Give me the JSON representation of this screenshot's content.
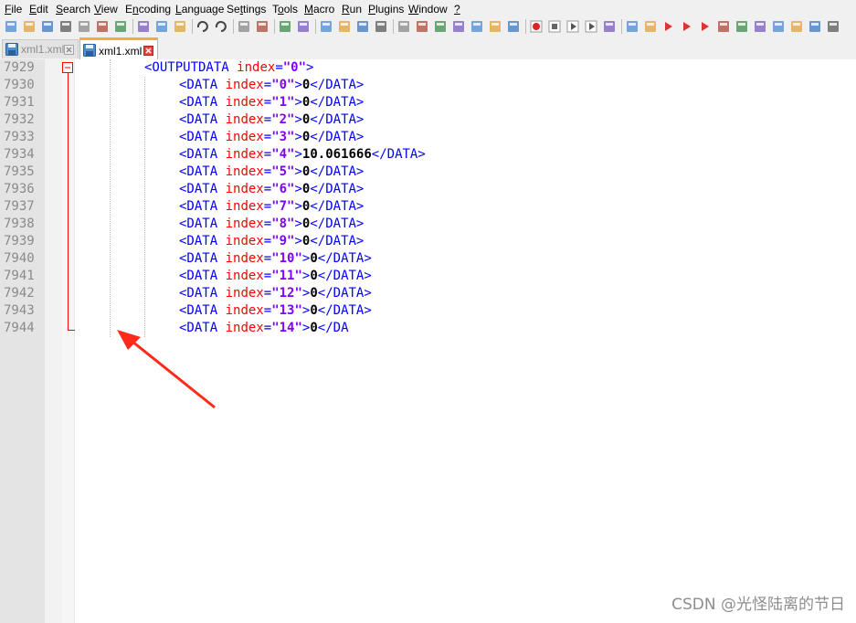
{
  "menu": [
    "File",
    "Edit",
    "Search",
    "View",
    "Encoding",
    "Language",
    "Settings",
    "Tools",
    "Macro",
    "Run",
    "Plugins",
    "Window",
    "?"
  ],
  "menu_underline": [
    "F",
    "E",
    "S",
    "V",
    "n",
    "L",
    "t",
    "o",
    "M",
    "R",
    "P",
    "W",
    "?"
  ],
  "toolbar_icons": [
    "new-file",
    "open-file",
    "save",
    "save-all",
    "close",
    "close-all",
    "print",
    "cut",
    "copy",
    "paste",
    "undo",
    "redo",
    "find",
    "replace",
    "zoom-in",
    "zoom-out",
    "sync-vertical",
    "sync-horizontal",
    "word-wrap",
    "show-all-chars",
    "indent-guide",
    "user-lang",
    "doc-map",
    "function-list",
    "folder-workspace",
    "document-switcher",
    "monitoring",
    "record-macro",
    "stop-recording",
    "play-macro",
    "play-multiple",
    "save-macro",
    "launch",
    "spell-check",
    "prev-bookmark",
    "next-bookmark",
    "bookmark",
    "mark-all",
    "compare",
    "clear",
    "plugin-1",
    "plugin-2",
    "plugin-3",
    "plugin-4"
  ],
  "tabs": [
    {
      "label": "xml1.xml",
      "active": false
    },
    {
      "label": "xml1.xml",
      "active": true
    }
  ],
  "editor": {
    "lines": [
      {
        "num": "7929",
        "indent": 1,
        "tag_open": "<OUTPUTDATA",
        "attr": "index",
        "eq": "=",
        "val": "\"0\"",
        "close": ">",
        "text": "",
        "end": ""
      },
      {
        "num": "7930",
        "indent": 2,
        "tag_open": "<DATA",
        "attr": "index",
        "eq": "=",
        "val": "\"0\"",
        "close": ">",
        "text": "0",
        "end": "</DATA>"
      },
      {
        "num": "7931",
        "indent": 2,
        "tag_open": "<DATA",
        "attr": "index",
        "eq": "=",
        "val": "\"1\"",
        "close": ">",
        "text": "0",
        "end": "</DATA>"
      },
      {
        "num": "7932",
        "indent": 2,
        "tag_open": "<DATA",
        "attr": "index",
        "eq": "=",
        "val": "\"2\"",
        "close": ">",
        "text": "0",
        "end": "</DATA>"
      },
      {
        "num": "7933",
        "indent": 2,
        "tag_open": "<DATA",
        "attr": "index",
        "eq": "=",
        "val": "\"3\"",
        "close": ">",
        "text": "0",
        "end": "</DATA>"
      },
      {
        "num": "7934",
        "indent": 2,
        "tag_open": "<DATA",
        "attr": "index",
        "eq": "=",
        "val": "\"4\"",
        "close": ">",
        "text": "10.061666",
        "end": "</DATA>"
      },
      {
        "num": "7935",
        "indent": 2,
        "tag_open": "<DATA",
        "attr": "index",
        "eq": "=",
        "val": "\"5\"",
        "close": ">",
        "text": "0",
        "end": "</DATA>"
      },
      {
        "num": "7936",
        "indent": 2,
        "tag_open": "<DATA",
        "attr": "index",
        "eq": "=",
        "val": "\"6\"",
        "close": ">",
        "text": "0",
        "end": "</DATA>"
      },
      {
        "num": "7937",
        "indent": 2,
        "tag_open": "<DATA",
        "attr": "index",
        "eq": "=",
        "val": "\"7\"",
        "close": ">",
        "text": "0",
        "end": "</DATA>"
      },
      {
        "num": "7938",
        "indent": 2,
        "tag_open": "<DATA",
        "attr": "index",
        "eq": "=",
        "val": "\"8\"",
        "close": ">",
        "text": "0",
        "end": "</DATA>"
      },
      {
        "num": "7939",
        "indent": 2,
        "tag_open": "<DATA",
        "attr": "index",
        "eq": "=",
        "val": "\"9\"",
        "close": ">",
        "text": "0",
        "end": "</DATA>"
      },
      {
        "num": "7940",
        "indent": 2,
        "tag_open": "<DATA",
        "attr": "index",
        "eq": "=",
        "val": "\"10\"",
        "close": ">",
        "text": "0",
        "end": "</DATA>"
      },
      {
        "num": "7941",
        "indent": 2,
        "tag_open": "<DATA",
        "attr": "index",
        "eq": "=",
        "val": "\"11\"",
        "close": ">",
        "text": "0",
        "end": "</DATA>"
      },
      {
        "num": "7942",
        "indent": 2,
        "tag_open": "<DATA",
        "attr": "index",
        "eq": "=",
        "val": "\"12\"",
        "close": ">",
        "text": "0",
        "end": "</DATA>"
      },
      {
        "num": "7943",
        "indent": 2,
        "tag_open": "<DATA",
        "attr": "index",
        "eq": "=",
        "val": "\"13\"",
        "close": ">",
        "text": "0",
        "end": "</DATA>"
      },
      {
        "num": "7944",
        "indent": 2,
        "tag_open": "<DATA",
        "attr": "index",
        "eq": "=",
        "val": "\"14\"",
        "close": ">",
        "text": "0",
        "end": "</DA"
      }
    ]
  },
  "colors": {
    "tag": "#0000ff",
    "attr": "#ff0000",
    "value": "#8000ff",
    "fold_line": "#ff0000",
    "annotation_arrow": "#ff2a1a",
    "active_tab_accent": "#f9a73e"
  },
  "watermark": "CSDN @光怪陆离的节日"
}
